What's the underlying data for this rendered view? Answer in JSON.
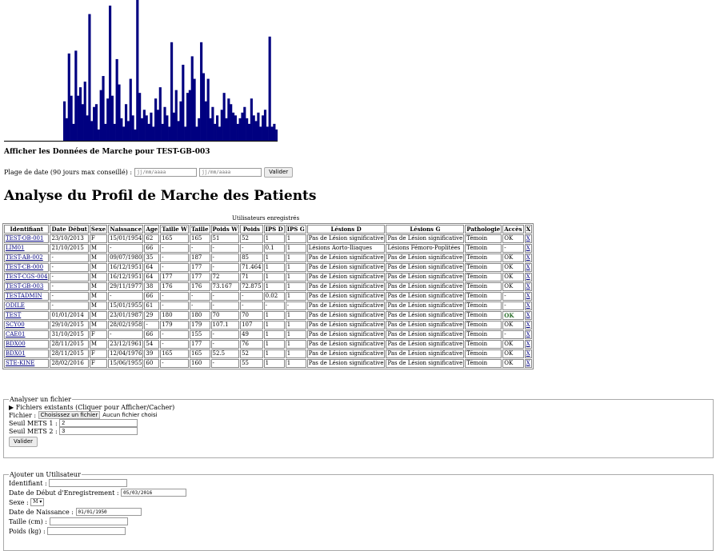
{
  "chart_data": {
    "type": "bar",
    "title": "",
    "xlabel": "",
    "ylabel": "",
    "ylim": [
      0,
      100
    ],
    "bar_color": "#000080",
    "values": [
      28,
      16,
      62,
      32,
      12,
      64,
      32,
      38,
      26,
      42,
      18,
      90,
      14,
      24,
      26,
      8,
      36,
      46,
      12,
      30,
      96,
      32,
      12,
      58,
      40,
      16,
      10,
      26,
      14,
      44,
      18,
      8,
      100,
      34,
      16,
      22,
      18,
      12,
      20,
      10,
      30,
      22,
      38,
      12,
      24,
      18,
      10,
      70,
      20,
      36,
      14,
      28,
      54,
      10,
      34,
      36,
      60,
      44,
      10,
      16,
      70,
      48,
      28,
      44,
      16,
      24,
      12,
      18,
      10,
      22,
      34,
      16,
      30,
      26,
      20,
      18,
      12,
      16,
      20,
      24,
      16,
      12,
      30,
      18,
      14,
      20,
      10,
      18,
      22,
      10,
      74,
      10,
      12,
      8
    ]
  },
  "display": {
    "heading": "Afficher les Données de Marche pour TEST-GB-003",
    "range_label": "Plage de date (90 jours max conseillé) :",
    "date_start_placeholder": "jj/mm/aaaa",
    "date_end_placeholder": "jj/mm/aaaa",
    "validate_label": "Valider"
  },
  "analysis": {
    "title": "Analyse du Profil de Marche des Patients"
  },
  "users_table": {
    "caption": "Utilisateurs enregistrés",
    "headers": [
      "Identifiant",
      "Date Début",
      "Sexe",
      "Naissance",
      "Age",
      "Taille W",
      "Taille",
      "Poids W",
      "Poids",
      "IPS D",
      "IPS G",
      "Lésions D",
      "Lésions G",
      "Pathologie",
      "Accès",
      "X"
    ],
    "rows": [
      [
        "TEST-OB-001",
        "23/10/2013",
        "F",
        "15/01/1954",
        "62",
        "165",
        "165",
        "51",
        "52",
        "1",
        "1",
        "Pas de Lésion significative",
        "Pas de Lésion significative",
        "Témoin",
        "OK",
        "X"
      ],
      [
        "LIM01",
        "21/10/2015",
        "M",
        "-",
        "66",
        "-",
        "-",
        "-",
        "-",
        "0.1",
        "1",
        "Lésions Aorto-Iliaques",
        "Lésions Fémoro-Poplitées",
        "Témoin",
        "-",
        "X"
      ],
      [
        "TEST-AB-002",
        "-",
        "M",
        "09/07/1980",
        "35",
        "-",
        "187",
        "-",
        "85",
        "1",
        "1",
        "Pas de Lésion significative",
        "Pas de Lésion significative",
        "Témoin",
        "OK",
        "X"
      ],
      [
        "TEST-CB-000",
        "-",
        "M",
        "16/12/1951",
        "64",
        "-",
        "177",
        "-",
        "71.464",
        "1",
        "1",
        "Pas de Lésion significative",
        "Pas de Lésion significative",
        "Témoin",
        "OK",
        "X"
      ],
      [
        "TEST-CGS-004",
        "-",
        "M",
        "16/12/1951",
        "64",
        "177",
        "177",
        "72",
        "71",
        "1",
        "1",
        "Pas de Lésion significative",
        "Pas de Lésion significative",
        "Témoin",
        "OK",
        "X"
      ],
      [
        "TEST-GB-003",
        "-",
        "M",
        "29/11/1977",
        "38",
        "176",
        "176",
        "73.167",
        "72.875",
        "1",
        "1",
        "Pas de Lésion significative",
        "Pas de Lésion significative",
        "Témoin",
        "OK",
        "X"
      ],
      [
        "TESTADMIN",
        "-",
        "M",
        "-",
        "66",
        "-",
        "-",
        "-",
        "-",
        "0.02",
        "1",
        "Pas de Lésion significative",
        "Pas de Lésion significative",
        "Témoin",
        "-",
        "X"
      ],
      [
        "ODILE",
        "-",
        "M",
        "15/01/1955",
        "61",
        "-",
        "-",
        "-",
        "-",
        "-",
        "-",
        "Pas de Lésion significative",
        "Pas de Lésion significative",
        "Témoin",
        "-",
        "X"
      ],
      [
        "TEST",
        "01/01/2014",
        "M",
        "23/01/1987",
        "29",
        "180",
        "180",
        "70",
        "70",
        "1",
        "1",
        "Pas de Lésion significative",
        "Pas de Lésion significative",
        "Témoin",
        "OK",
        "X"
      ],
      [
        "SCY00",
        "29/10/2015",
        "M",
        "28/02/1958",
        "-",
        "179",
        "179",
        "107.1",
        "107",
        "1",
        "1",
        "Pas de Lésion significative",
        "Pas de Lésion significative",
        "Témoin",
        "OK",
        "X"
      ],
      [
        "CAE01",
        "31/10/2015",
        "F",
        "-",
        "66",
        "-",
        "155",
        "-",
        "49",
        "1",
        "1",
        "Pas de Lésion significative",
        "Pas de Lésion significative",
        "Témoin",
        "-",
        "X"
      ],
      [
        "BDX00",
        "28/11/2015",
        "M",
        "23/12/1961",
        "54",
        "-",
        "177",
        "-",
        "76",
        "1",
        "1",
        "Pas de Lésion significative",
        "Pas de Lésion significative",
        "Témoin",
        "OK",
        "X"
      ],
      [
        "BDX01",
        "28/11/2015",
        "F",
        "12/04/1976",
        "39",
        "165",
        "165",
        "52.5",
        "52",
        "1",
        "1",
        "Pas de Lésion significative",
        "Pas de Lésion significative",
        "Témoin",
        "OK",
        "X"
      ],
      [
        "STE-KINE",
        "28/02/2016",
        "F",
        "15/06/1955",
        "60",
        "-",
        "160",
        "-",
        "55",
        "1",
        "1",
        "Pas de Lésion significative",
        "Pas de Lésion significative",
        "Témoin",
        "OK",
        "X"
      ]
    ],
    "highlight_ok_row": 8,
    "highlight_color": "#2a6e2a"
  },
  "file_section": {
    "legend": "Analyser un fichier",
    "existing_toggle": "▶ Fichiers existants (Cliquer pour Afficher/Cacher)",
    "file_label": "Fichier :",
    "choose_button": "Choisissez un fichier",
    "no_file": "Aucun fichier choisi",
    "mets1_label": "Seuil METS 1 :",
    "mets1_value": "2",
    "mets2_label": "Seuil METS 2 :",
    "mets2_value": "3",
    "validate_label": "Valider"
  },
  "add_user": {
    "legend": "Ajouter un Utilisateur",
    "id_label": "Identifiant :",
    "start_label": "Date de Début d'Enregistrement :",
    "start_value": "05/03/2016",
    "sex_label": "Sexe :",
    "sex_value": "M",
    "birth_label": "Date de Naissance :",
    "birth_value": "01/01/1950",
    "height_label": "Taille (cm) :",
    "weight_label": "Poids (kg) :"
  }
}
